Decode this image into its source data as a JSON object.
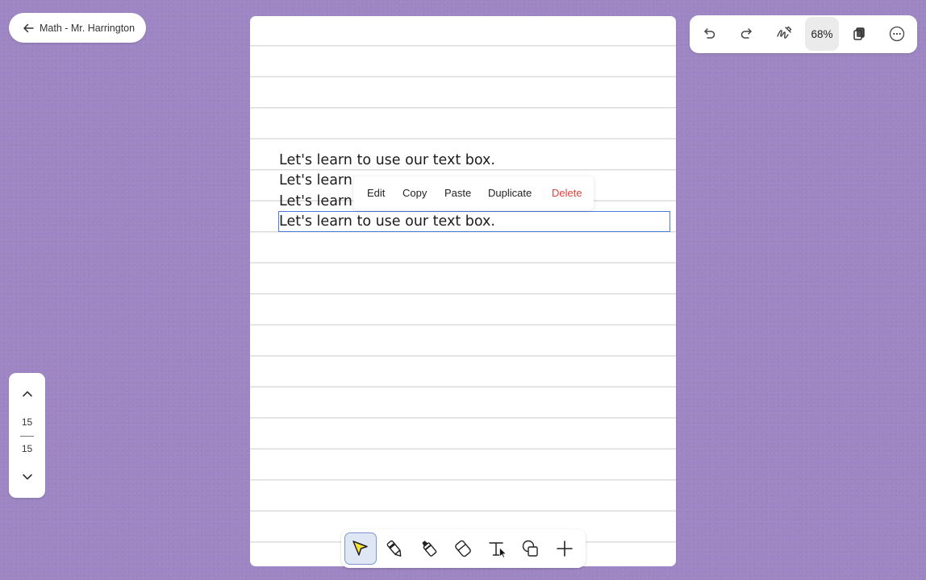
{
  "back_button": {
    "label": "Math - Mr. Harrington",
    "icon": "arrow-left-icon"
  },
  "top_toolbar": {
    "undo_icon": "undo-icon",
    "redo_icon": "redo-icon",
    "pen_gesture_icon": "gesture-icon",
    "zoom": "68%",
    "pages_icon": "pages-icon",
    "more_icon": "more-icon"
  },
  "page": {
    "lines": [
      "Let's learn to use our text box.",
      "Let's learn",
      "Let's learn",
      "Let's learn to use our text box."
    ]
  },
  "context_menu": {
    "items": [
      "Edit",
      "Copy",
      "Paste",
      "Duplicate",
      "Delete"
    ],
    "delete_color": "#e0403a"
  },
  "page_nav": {
    "current": "15",
    "total": "15"
  },
  "tools": {
    "items": [
      "select-tool",
      "pen-tool",
      "marker-tool",
      "eraser-tool",
      "text-tool",
      "shape-tool",
      "add-tool"
    ],
    "active": "select-tool",
    "active_color": "#f5e23a"
  },
  "colors": {
    "background": "#9d86c3",
    "selection": "#4a7bd8"
  }
}
